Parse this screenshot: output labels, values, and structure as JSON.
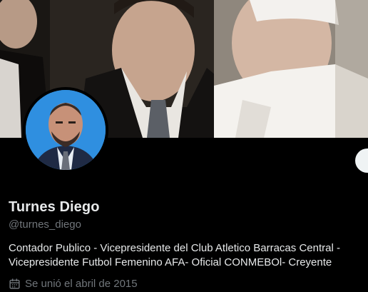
{
  "profile": {
    "display_name": "Turnes Diego",
    "handle": "@turnes_diego",
    "bio_line1": "Contador Publico - Vicepresidente del Club Atletico Barracas Central -",
    "bio_line2": "Vicepresidente Futbol Femenino AFA- Oficial CONMEBOl- Creyente",
    "joined_text": "Se unió el abril de 2015"
  },
  "icons": {
    "calendar": "calendar-icon"
  },
  "colors": {
    "background": "#000000",
    "primary_text": "#e7e9ea",
    "secondary_text": "#71767b",
    "avatar_background": "#2f8fe0"
  }
}
